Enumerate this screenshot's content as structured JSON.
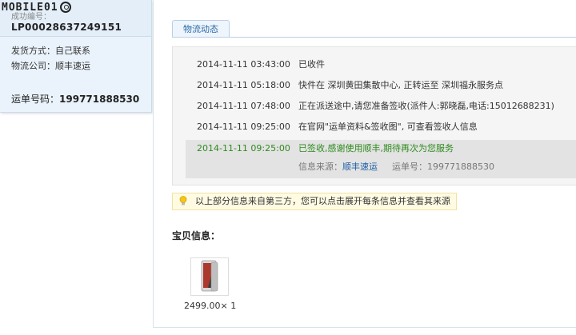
{
  "watermark": "MOBILE01",
  "left": {
    "cut_label": "成功编号：",
    "order_no": "LP00028637249151",
    "ship_method": "发货方式：自己联系",
    "carrier": "物流公司：顺丰速运",
    "tracking_label": "运单号码：",
    "tracking_no": "199771888530"
  },
  "tab": {
    "label": "物流动态"
  },
  "events": [
    {
      "time": "2014-11-11 03:43:00",
      "msg": "已收件"
    },
    {
      "time": "2014-11-11 05:18:00",
      "msg": "快件在 深圳黄田集散中心, 正转运至 深圳福永服务点"
    },
    {
      "time": "2014-11-11 07:48:00",
      "msg": "正在派送途中,请您准备签收(派件人:郭晓磊,电话:15012688231)"
    },
    {
      "time": "2014-11-11 09:25:00",
      "msg": "在官网\"运单资料&签收图\", 可查看签收人信息"
    },
    {
      "time": "2014-11-11 09:25:00",
      "msg": "已签收,感谢使用顺丰,期待再次为您服务"
    }
  ],
  "source": {
    "label": "信息来源：",
    "link": "顺丰速运",
    "waybill": "运单号：199771888530"
  },
  "notice": "以上部分信息来自第三方，您可以点击展开每条信息并查看其来源",
  "product": {
    "section_title": "宝贝信息：",
    "price": "2499.00× 1"
  },
  "colors": {
    "link": "#1f5fa8",
    "success": "#2f8a1e",
    "tab_text": "#2a6aa8"
  }
}
